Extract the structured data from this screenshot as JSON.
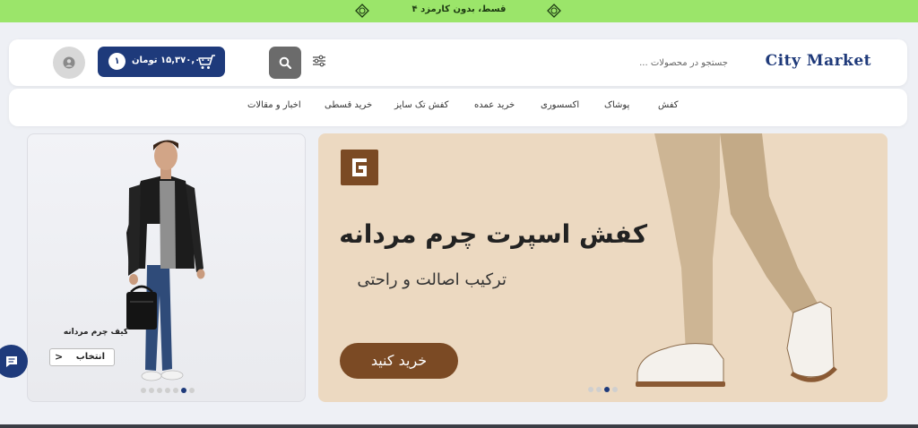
{
  "promo": {
    "text": "۴ قسط، بدون کارمزد"
  },
  "header": {
    "logo": "City Market",
    "search": {
      "placeholder": "جستجو در محصولات ...",
      "value": ""
    },
    "cart": {
      "badge": "۱",
      "amount": "۱۵,۳۷۰,۰۰۰ تومان"
    }
  },
  "nav": {
    "items": [
      {
        "label": "کفش"
      },
      {
        "label": "پوشاک"
      },
      {
        "label": "اکسسوری"
      },
      {
        "label": "خرید عمده"
      },
      {
        "label": "کفش تک سایز"
      },
      {
        "label": "خرید قسطی"
      },
      {
        "label": "اخبار و مقالات"
      }
    ]
  },
  "side_banner": {
    "title": "کیف چرم مردانه",
    "select_label": "انتخاب",
    "select_arrow": ">"
  },
  "hero": {
    "title": "کفش اسپرت چرم مردانه",
    "subtitle": "ترکیب اصالت و راحتی",
    "button": "خرید کنید"
  },
  "colors": {
    "promo": "#9be56a",
    "brand": "#1e3a7b",
    "hero_bg": "#ecd9c1",
    "hero_accent": "#7b4a24"
  },
  "icons": [
    "diamond-deco-icon",
    "filter-icon",
    "search-icon",
    "cart-icon",
    "user-icon",
    "chat-icon"
  ]
}
